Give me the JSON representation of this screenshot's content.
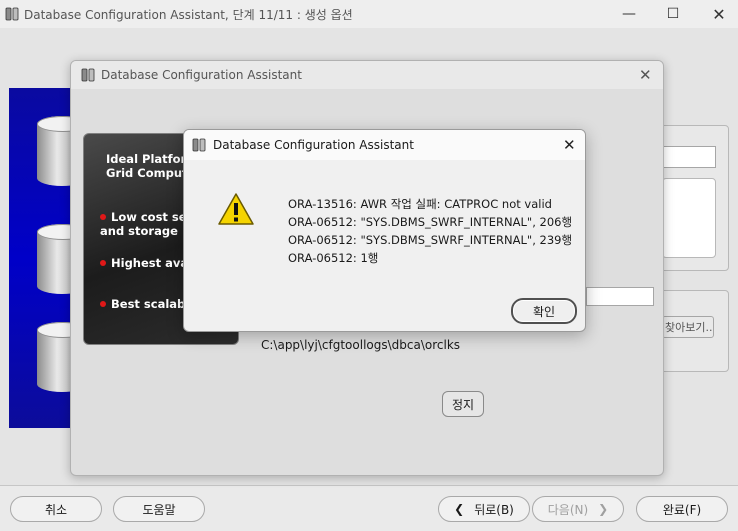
{
  "app": {
    "title": "Database Configuration Assistant, 단계 11/11 : 생성 옵션"
  },
  "progress_dialog": {
    "title": "Database Configuration Assistant",
    "log_path": "C:\\app\\lyj\\cfgtoollogs\\dbca\\orclks",
    "stop_label": "정지"
  },
  "promo": {
    "heading": "Ideal Platform for\nGrid Computing",
    "bullets": [
      "Low cost servers\nand storage",
      "Highest availability",
      "Best scalability"
    ]
  },
  "background": {
    "browse_label": "찾아보기..."
  },
  "error_dialog": {
    "title": "Database Configuration Assistant",
    "lines": [
      "ORA-13516: AWR 작업 실패: CATPROC not valid",
      "ORA-06512: \"SYS.DBMS_SWRF_INTERNAL\",  206행",
      "ORA-06512: \"SYS.DBMS_SWRF_INTERNAL\",  239행",
      "ORA-06512:  1행"
    ],
    "ok_label": "확인"
  },
  "footer": {
    "cancel_label": "취소",
    "help_label": "도움말",
    "back_label": "뒤로(B)",
    "next_label": "다음(N)",
    "finish_label": "완료(F)"
  },
  "icons": {
    "window_minimize": "minimize-icon",
    "window_maximize": "maximize-icon",
    "window_close": "close-icon",
    "app_icon": "database-icon",
    "warning_icon": "warning-icon"
  },
  "colors": {
    "banner_blue": "#0000c8",
    "bullet_red": "#e01818",
    "warning_yellow": "#f5d400"
  }
}
